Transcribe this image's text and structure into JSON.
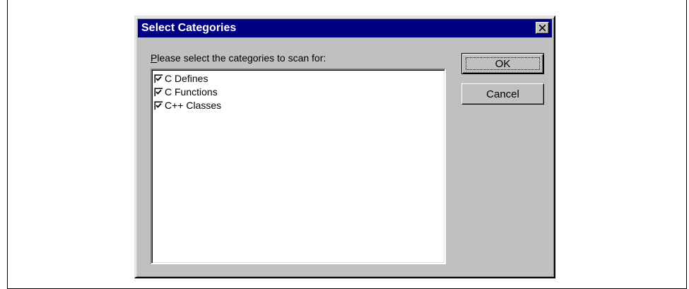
{
  "dialog": {
    "title": "Select Categories",
    "close_label": "✕",
    "prompt_first_letter": "P",
    "prompt_rest": "lease select the categories to scan for:",
    "categories": [
      {
        "label": "C Defines",
        "checked": true
      },
      {
        "label": "C Functions",
        "checked": true
      },
      {
        "label": "C++ Classes",
        "checked": true
      }
    ],
    "ok_label": "OK",
    "cancel_label": "Cancel"
  }
}
